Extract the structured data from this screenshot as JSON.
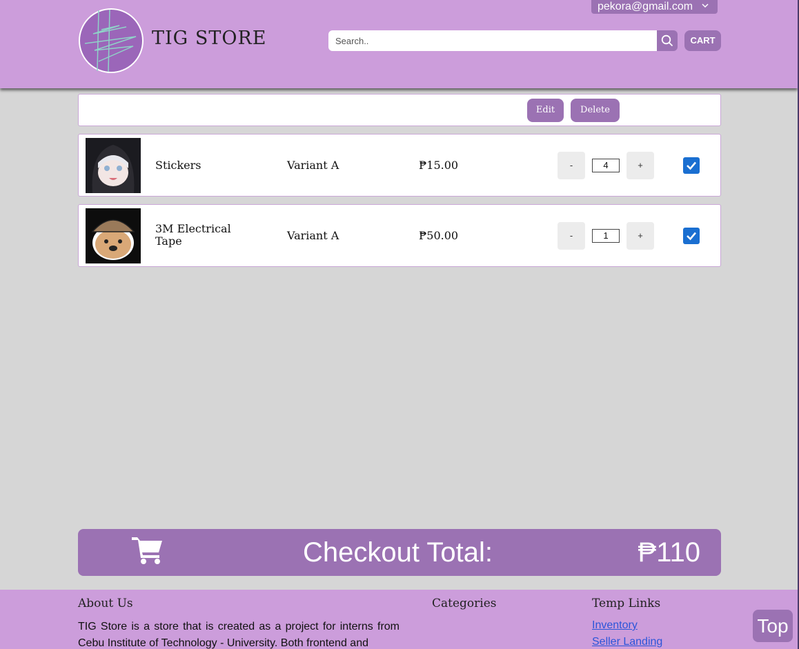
{
  "header": {
    "user_email": "pekora@gmail.com",
    "brand": "TIG STORE",
    "search_placeholder": "Search..",
    "cart_label": "CART"
  },
  "toolbar": {
    "edit_label": "Edit",
    "delete_label": "Delete"
  },
  "cart": {
    "items": [
      {
        "name": "Stickers",
        "variant": "Variant A",
        "price": "₱15.00",
        "quantity": "4",
        "selected": true,
        "image": "anime-girl-hood-thumbnail"
      },
      {
        "name": "3M Electrical Tape",
        "variant": "Variant A",
        "price": "₱50.00",
        "quantity": "1",
        "selected": true,
        "image": "detective-dog-thumbnail"
      }
    ],
    "minus_label": "-",
    "plus_label": "+"
  },
  "checkout": {
    "label": "Checkout Total:",
    "total": "₱110"
  },
  "footer": {
    "about_title": "About Us",
    "about_text": "TIG Store is a store that is created as a project for interns from Cebu Institute of Technology - University. Both frontend and",
    "categories_title": "Categories",
    "links_title": "Temp Links",
    "links": [
      "Inventory",
      "Seller Landing"
    ]
  },
  "top_button": "Top",
  "colors": {
    "header_bg": "#cc9ddb",
    "accent": "#9b72b3",
    "page_bg": "#d6d6d6",
    "checkbox": "#1a6fd1",
    "link": "#2b55d9"
  }
}
